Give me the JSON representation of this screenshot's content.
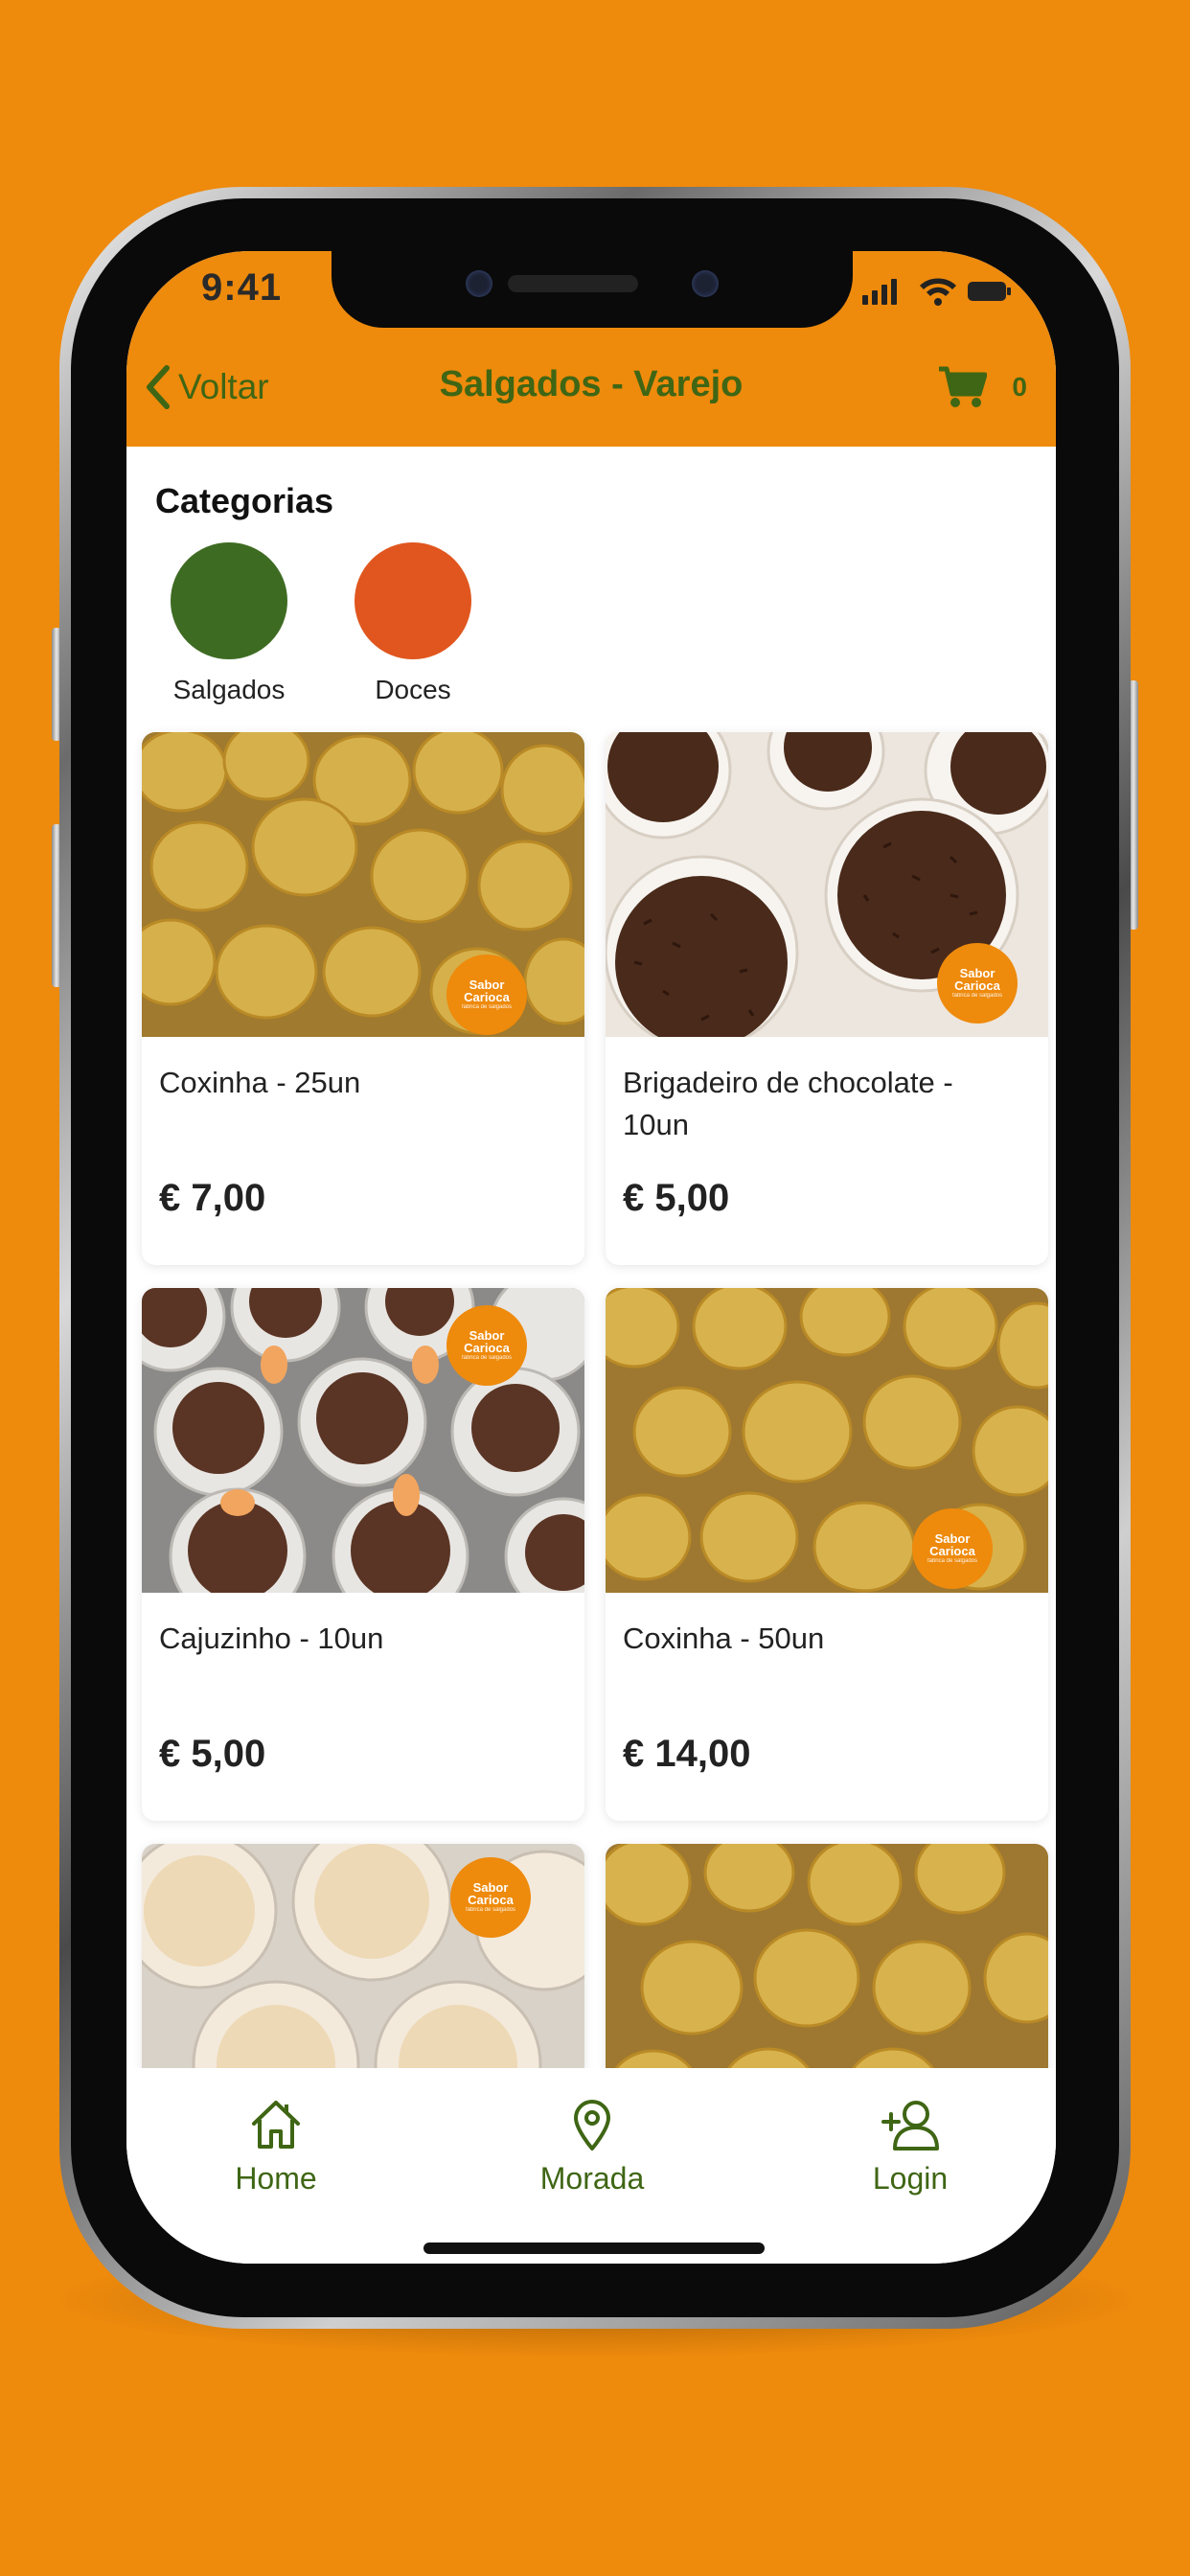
{
  "status_bar": {
    "time": "9:41"
  },
  "nav": {
    "back_label": "Voltar",
    "title": "Salgados - Varejo",
    "cart_count": "0"
  },
  "categories": {
    "title": "Categorias",
    "items": [
      {
        "label": "Salgados",
        "color": "#3E6B22"
      },
      {
        "label": "Doces",
        "color": "#E0561E"
      }
    ]
  },
  "brand_badge": {
    "line1": "Sabor",
    "line2": "Carioca",
    "line3": "fábrica de salgados"
  },
  "products": [
    {
      "name": "Coxinha - 25un",
      "price": "€ 7,00"
    },
    {
      "name": "Brigadeiro de chocolate - 10un",
      "price": "€ 5,00"
    },
    {
      "name": "Cajuzinho - 10un",
      "price": "€ 5,00"
    },
    {
      "name": "Coxinha - 50un",
      "price": "€ 14,00"
    },
    {
      "name": "",
      "price": ""
    },
    {
      "name": "",
      "price": ""
    }
  ],
  "tabbar": {
    "home": "Home",
    "address": "Morada",
    "login": "Login"
  },
  "colors": {
    "background": "#EE8A0C",
    "accent": "#3F6614",
    "brand": "#EE8A0C"
  }
}
